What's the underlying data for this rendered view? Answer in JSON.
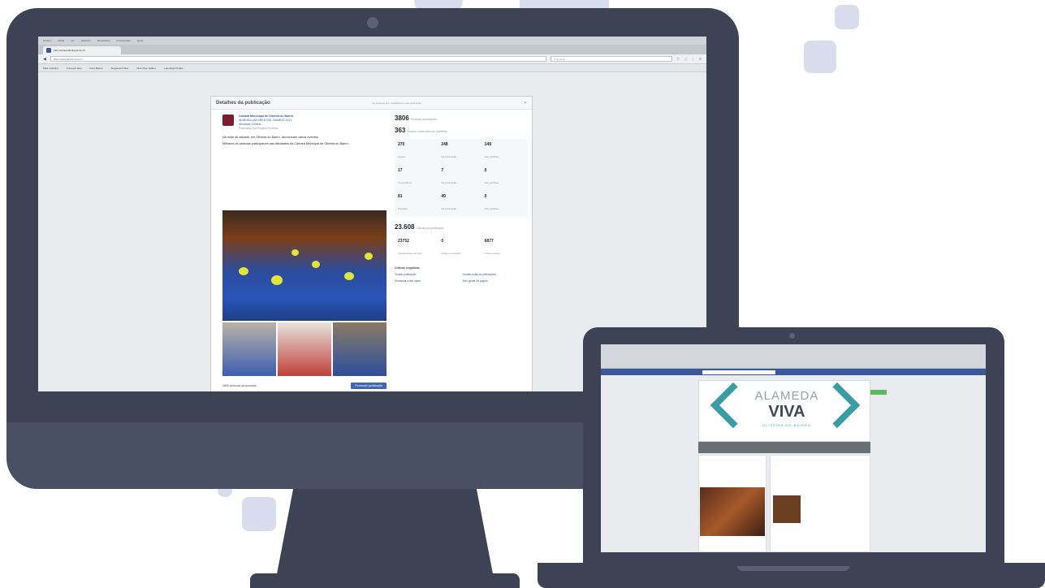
{
  "desktop": {
    "browser": {
      "menu": [
        "Ficheiro",
        "Editar",
        "Ver",
        "Histórico",
        "Marcadores",
        "Ferramentas",
        "Ajuda"
      ],
      "tab_title": "(30) Câmara Municipal de Ol...",
      "url": "https://www.facebook.com/...",
      "search_placeholder": "Pesquisar",
      "bookmarks": [
        "Mais visitados",
        "Começar aqui",
        "Para Before",
        "Suggested Sites",
        "Web Slice Gallery",
        "Lansakga Portais"
      ]
    },
    "dialog": {
      "title": "Detalhes da publicação",
      "subtitle": "As pessoas que visualizaram esta publicação",
      "post": {
        "page_name": "Câmara Municipal de Oliveira do Bairro",
        "meta_1": "ALMEIDA UM DRED DEL DIAMOS 2012",
        "meta_2": "Atividade Central",
        "time": "Publicado por Regina Ferreira",
        "text_1": "Na noite de sábado, em Oliveira do Bairro, decorreram vários eventos.",
        "text_2": "Milhares de pessoas participaram nas atividades da Câmara Municipal de Oliveira do Bairro.",
        "reach": "3806 pessoas alcançadas",
        "boost_label": "Promover publicação"
      },
      "insights": {
        "reach": "3806",
        "reach_label": "Pessoas alcançadas",
        "engagement": "363",
        "engagement_label": "Gostos, comentários e partilhas",
        "metrics": [
          {
            "value": "270",
            "label": "Gostos"
          },
          {
            "value": "248",
            "label": "Na publicação"
          },
          {
            "value": "149",
            "label": "Nas partilhas"
          },
          {
            "value": "17",
            "label": "Comentários"
          },
          {
            "value": "7",
            "label": "Na publicação"
          },
          {
            "value": "0",
            "label": "Nas partilhas"
          },
          {
            "value": "81",
            "label": "Partilhas"
          },
          {
            "value": "49",
            "label": "Na publicação"
          },
          {
            "value": "0",
            "label": "Nas partilhas"
          }
        ],
        "clicks": "23.608",
        "clicks_label": "Cliques na publicação",
        "click_metrics": [
          {
            "value": "23752",
            "label": "Visualizações de fotos"
          },
          {
            "value": "0",
            "label": "Cliques na ligação"
          },
          {
            "value": "6877",
            "label": "Outros cliques"
          }
        ],
        "negative_title": "Críticas negativas",
        "negative": [
          "Ocultar publicação",
          "Ocultar todas as publicações",
          "Denunciar como spam",
          "Não gostar da página"
        ]
      }
    }
  },
  "laptop": {
    "cover_title": "ALAMEDA",
    "cover_title_2": "VIVA",
    "cover_subtitle": "OLIVEIRA DO BAIRRO"
  }
}
